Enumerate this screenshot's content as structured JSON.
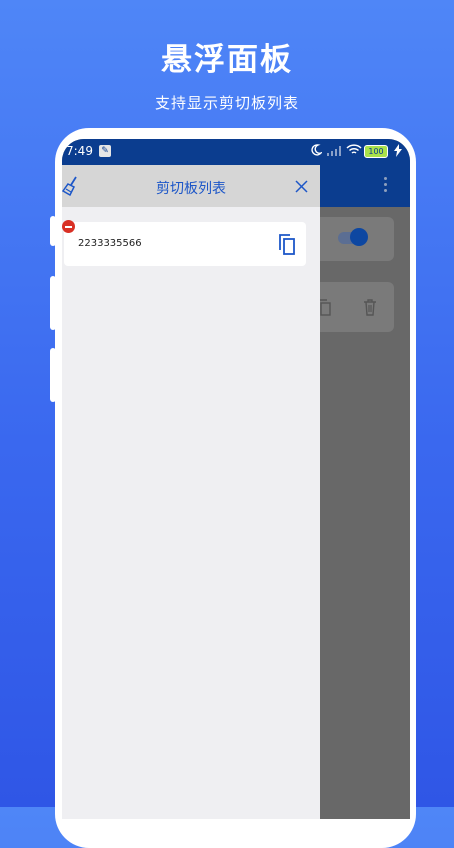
{
  "promo": {
    "title": "悬浮面板",
    "subtitle": "支持显示剪切板列表"
  },
  "status_bar": {
    "time": "7:49",
    "battery": "100",
    "icons": [
      "wrench-icon",
      "moon-icon",
      "signal-icon",
      "wifi-icon",
      "battery-icon",
      "charging-icon"
    ]
  },
  "panel": {
    "title": "剪切板列表",
    "items": [
      {
        "text": "2233335566"
      }
    ]
  },
  "colors": {
    "background_top": "#4f86f7",
    "background_bottom": "#2f56e6",
    "app_bar": "#0b3d8f",
    "accent": "#1d57c8",
    "remove": "#d93025"
  }
}
